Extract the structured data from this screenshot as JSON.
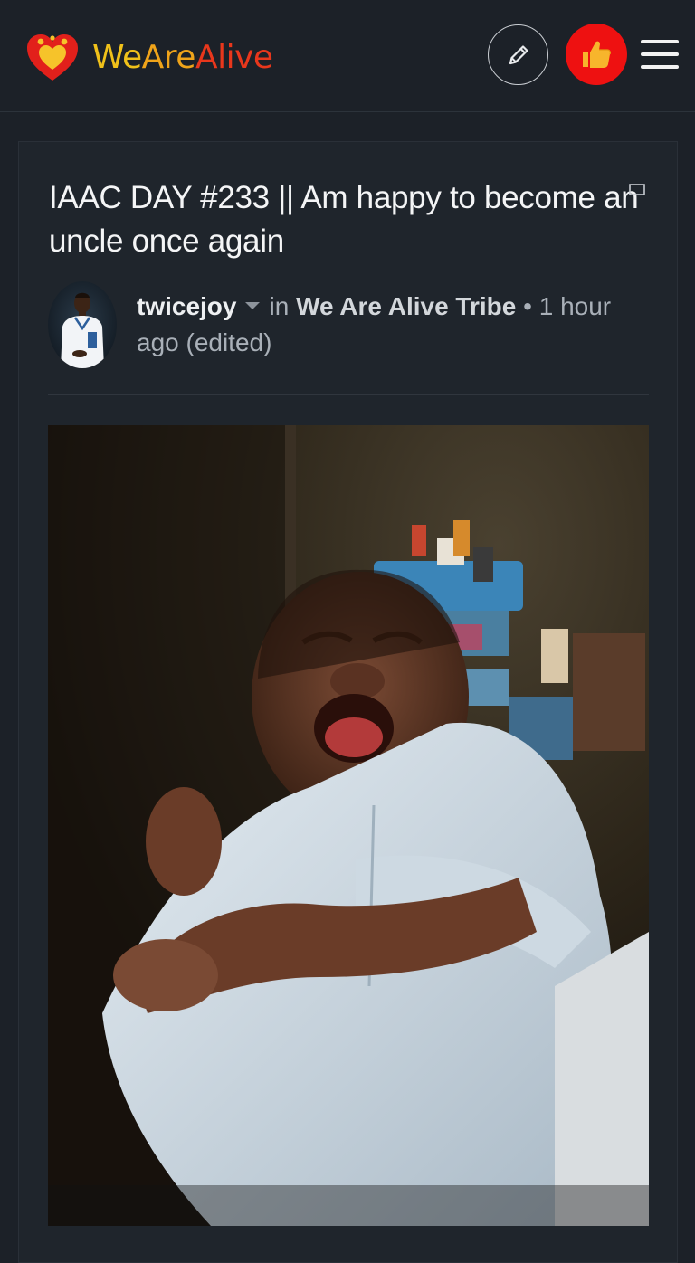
{
  "header": {
    "logo": {
      "part1": "We",
      "part2": "Are",
      "part3": "Alive"
    },
    "icons": {
      "heart": "heart-logo-icon",
      "pencil": "pencil-icon",
      "thumb": "thumbs-up-icon",
      "menu": "hamburger-menu-icon"
    },
    "colors": {
      "thumb_bg": "#ee1111",
      "logo_yellow": "#f0c11a",
      "logo_red": "#e8371c"
    }
  },
  "post": {
    "title": "IAAC DAY #233 || Am happy to become an uncle once again",
    "author": "twicejoy",
    "in_label": "in",
    "community": "We Are Alive Tribe",
    "separator": "•",
    "time": "1 hour ago (edited)",
    "flag_icon": "flag-icon",
    "image_subject": "crying-newborn-photo"
  }
}
